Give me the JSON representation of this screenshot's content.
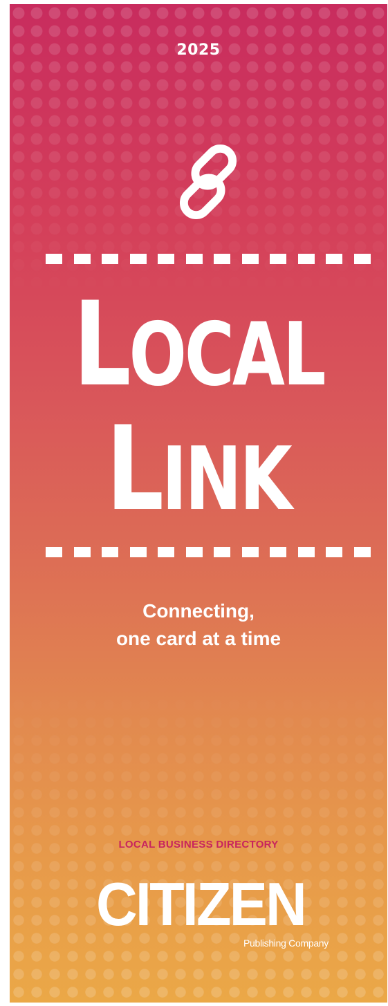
{
  "cover": {
    "year": "2025",
    "icon": "chain-link-icon",
    "title_line1": {
      "first": "L",
      "rest": "OCAL"
    },
    "title_line2": {
      "first": "L",
      "rest": "INK"
    },
    "tagline_line1": "Connecting,",
    "tagline_line2": "one card at a time",
    "directory_label": "LOCAL BUSINESS DIRECTORY",
    "publisher_name": "CITIZEN",
    "publisher_sub": "Publishing Company"
  },
  "colors": {
    "gradient_top": "#c82c5e",
    "gradient_bottom": "#eba847",
    "accent": "#c8245d",
    "text": "#ffffff"
  }
}
